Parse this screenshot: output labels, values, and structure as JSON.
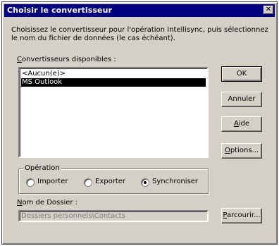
{
  "window": {
    "title": "Choisir le convertisseur",
    "close_glyph": "✕"
  },
  "description": "Choisissez le convertisseur pour l'opération Intellisync, puis sélectionnez le nom du fichier de données (le cas échéant).",
  "converters": {
    "label_hotkey": "C",
    "label_rest": "onvertisseurs disponibles :",
    "items": [
      "<Aucun(e)>",
      "MS Outlook"
    ],
    "selected_index": 1
  },
  "buttons": {
    "ok": "OK",
    "cancel": "Annuler",
    "help_hotkey": "A",
    "help_rest": "ide",
    "options_hotkey": "O",
    "options_rest": "ptions...",
    "browse_hotkey": "P",
    "browse_rest": "arcourir..."
  },
  "operation": {
    "legend": "Opération",
    "options": [
      "Importer",
      "Exporter",
      "Synchroniser"
    ],
    "selected": "Synchroniser"
  },
  "folder": {
    "label_hotkey": "N",
    "label_rest": "om de Dossier :",
    "value": "Dossiers personnels\\Contacts"
  }
}
